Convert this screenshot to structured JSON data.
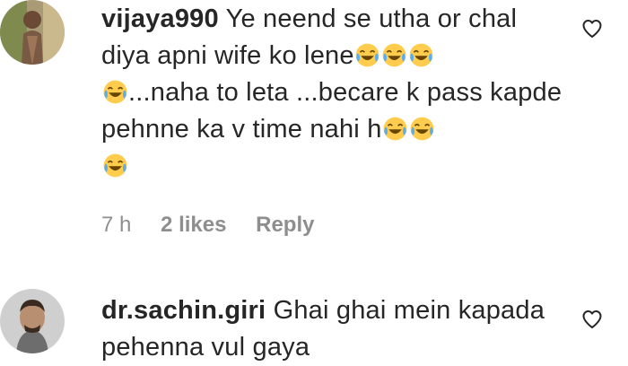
{
  "comments": [
    {
      "username": "vijaya990",
      "text_parts": {
        "p1": "Ye neend se utha or chal diya apni wife ko lene",
        "p2": "...naha to leta ...becare k pass kapde pehnne ka v time nahi h"
      },
      "emoji": "face-with-tears-of-joy",
      "time": "7 h",
      "likes": "2 likes",
      "reply_label": "Reply"
    },
    {
      "username": "dr.sachin.giri",
      "text": "Ghai ghai mein kapada pehenna vul gaya"
    }
  ],
  "colors": {
    "text": "#262626",
    "meta": "#8e8e8e",
    "emoji_face": "#FFCC4D"
  },
  "icons": {
    "like": "heart-outline-icon",
    "emoji": "face-with-tears-of-joy-icon"
  }
}
